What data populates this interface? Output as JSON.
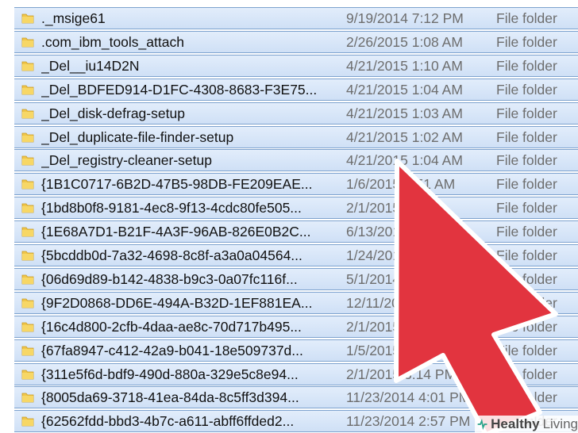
{
  "files": [
    {
      "name": "._msige61",
      "date": "9/19/2014 7:12 PM",
      "type": "File folder"
    },
    {
      "name": ".com_ibm_tools_attach",
      "date": "2/26/2015 1:08 AM",
      "type": "File folder"
    },
    {
      "name": "_Del__iu14D2N",
      "date": "4/21/2015 1:10 AM",
      "type": "File folder"
    },
    {
      "name": "_Del_BDFED914-D1FC-4308-8683-F3E75...",
      "date": "4/21/2015 1:04 AM",
      "type": "File folder"
    },
    {
      "name": "_Del_disk-defrag-setup",
      "date": "4/21/2015 1:03 AM",
      "type": "File folder"
    },
    {
      "name": "_Del_duplicate-file-finder-setup",
      "date": "4/21/2015 1:02 AM",
      "type": "File folder"
    },
    {
      "name": "_Del_registry-cleaner-setup",
      "date": "4/21/2015 1:04 AM",
      "type": "File folder"
    },
    {
      "name": "{1B1C0717-6B2D-47B5-98DB-FE209EAE...",
      "date": "1/6/2015 2:51 AM",
      "type": "File folder"
    },
    {
      "name": "{1bd8b0f8-9181-4ec8-9f13-4cdc80fe505...",
      "date": "2/1/2015 PM",
      "type": "File folder"
    },
    {
      "name": "{1E68A7D1-B21F-4A3F-96AB-826E0B2C...",
      "date": "6/13/2014",
      "type": "File folder"
    },
    {
      "name": "{5bcddb0d-7a32-4698-8c8f-a3a0a04564...",
      "date": "1/24/2015",
      "type": "File folder"
    },
    {
      "name": "{06d69d89-b142-4838-b9c3-0a07fc116f...",
      "date": "5/1/2014",
      "type": "File folder"
    },
    {
      "name": "{9F2D0868-DD6E-494A-B32D-1EF881EA...",
      "date": "12/11/2014",
      "type": "File folder"
    },
    {
      "name": "{16c4d800-2cfb-4daa-ae8c-70d717b495...",
      "date": "2/1/2015",
      "type": "File folder"
    },
    {
      "name": "{67fa8947-c412-42a9-b041-18e509737d...",
      "date": "1/5/2015 25 AM",
      "type": "File folder"
    },
    {
      "name": "{311e5f6d-bdf9-490d-880a-329e5c8e94...",
      "date": "2/1/2015 3:14 PM",
      "type": "File folder"
    },
    {
      "name": "{8005da69-3718-41ea-84da-8c5ff3d394...",
      "date": "11/23/2014 4:01 PM",
      "type": "File folder"
    },
    {
      "name": "{62562fdd-bbd3-4b7c-a611-abff6ffded2...",
      "date": "11/23/2014 2:57 PM",
      "type": "File folder"
    }
  ],
  "watermark": {
    "word1": "Healthy",
    "word2": "Living"
  },
  "colors": {
    "row_border": "#7da2ce",
    "row_fill_top": "#e2edfb",
    "row_fill_bottom": "#cfe0f6",
    "folder_icon": "#f0c64a",
    "cursor_fill": "#e2343f",
    "cursor_outline": "#ffffff",
    "watermark_logo": "#2aa38a"
  },
  "icons": {
    "folder": "folder-icon",
    "cursor": "mouse-pointer-icon",
    "logo": "healthy-living-logo-icon"
  }
}
